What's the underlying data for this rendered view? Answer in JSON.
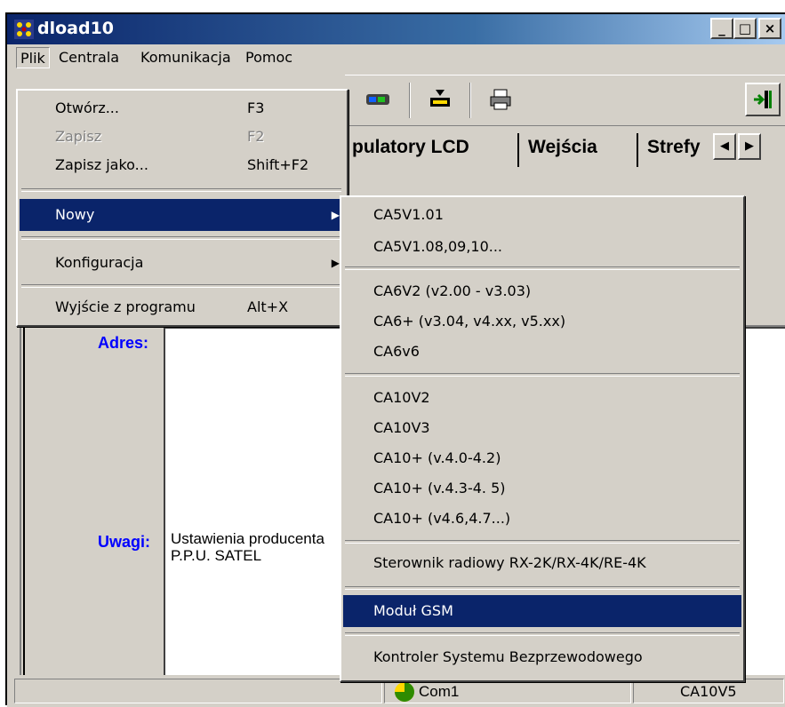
{
  "window": {
    "title": "dload10",
    "minimize": "_",
    "maximize": "□",
    "close": "×"
  },
  "menubar": [
    "Plik",
    "Centrala",
    "Komunikacja",
    "Pomoc"
  ],
  "file_menu": {
    "items": [
      {
        "label": "Otwórz...",
        "shortcut": "F3"
      },
      {
        "label": "Zapisz",
        "shortcut": "F2"
      },
      {
        "label": "Zapisz jako...",
        "shortcut": "Shift+F2"
      },
      {
        "label": "Nowy",
        "arrow": "▶"
      },
      {
        "label": "Konfiguracja",
        "arrow": "▶"
      },
      {
        "label": "Wyjście z programu",
        "shortcut": "Alt+X"
      }
    ]
  },
  "new_submenu": {
    "items": [
      "CA5V1.01",
      "CA5V1.08,09,10...",
      "CA6V2 (v2.00 - v3.03)",
      "CA6+ (v3.04, v4.xx, v5.xx)",
      "CA6v6",
      "CA10V2",
      "CA10V3",
      "CA10+ (v.4.0-4.2)",
      "CA10+ (v.4.3-4. 5)",
      "CA10+ (v4.6,4.7...)",
      "Sterownik radiowy RX-2K/RX-4K/RE-4K",
      "Moduł GSM",
      "Kontroler Systemu Bezprzewodowego"
    ]
  },
  "tabs": [
    "pulatory LCD",
    "Wejścia",
    "Strefy"
  ],
  "tab_arrows": {
    "left": "◀",
    "right": "▶"
  },
  "form": {
    "address_label": "Adres:",
    "notes_label": "Uwagi:",
    "notes_line1": "Ustawienia producenta",
    "notes_line2": "P.P.U. SATEL"
  },
  "status": {
    "port": "Com1",
    "device": "CA10V5"
  }
}
